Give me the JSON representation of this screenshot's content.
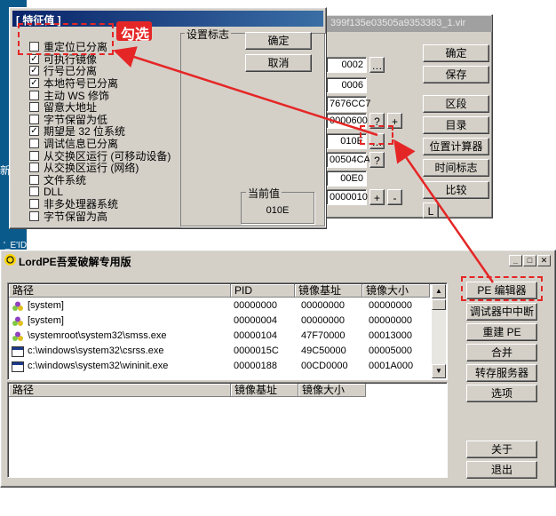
{
  "desktop": {
    "side_text": "新",
    "side_text2": "'_E'ID'"
  },
  "back_window": {
    "title": "399f135e03505a9353383_1.vir",
    "buttons": [
      "确定",
      "保存",
      "区段",
      "目录",
      "位置计算器",
      "时间标志",
      "比较"
    ],
    "small_L": "L",
    "values": [
      "0002",
      "0006",
      "7676CC7",
      "0000600",
      "010E",
      "00504CA",
      "00E0",
      "0000010"
    ]
  },
  "feature_dialog": {
    "title": "[ 特征值 ]",
    "flags": [
      {
        "label": "重定位已分离",
        "checked": false
      },
      {
        "label": "可执行镜像",
        "checked": true
      },
      {
        "label": "行号已分离",
        "checked": true
      },
      {
        "label": "本地符号已分离",
        "checked": true
      },
      {
        "label": "主动 WS 修饰",
        "checked": false
      },
      {
        "label": "留意大地址",
        "checked": false
      },
      {
        "label": "字节保留为低",
        "checked": false
      },
      {
        "label": "期望是 32 位系统",
        "checked": true
      },
      {
        "label": "调试信息已分离",
        "checked": false
      },
      {
        "label": "从交换区运行 (可移动设备)",
        "checked": false
      },
      {
        "label": "从交换区运行 (网络)",
        "checked": false
      },
      {
        "label": "文件系统",
        "checked": false
      },
      {
        "label": "DLL",
        "checked": false
      },
      {
        "label": "非多处理器系统",
        "checked": false
      },
      {
        "label": "字节保留为高",
        "checked": false
      }
    ],
    "group_label": "设置标志",
    "ok": "确定",
    "cancel": "取消",
    "current_label": "当前值",
    "current_value": "010E"
  },
  "annotation": {
    "text": "勾选",
    "color": "#e52626"
  },
  "lordpe": {
    "title": "LordPE吾爱破解专用版",
    "proc_headers": [
      "路径",
      "PID",
      "镜像基址",
      "镜像大小"
    ],
    "processes": [
      {
        "icon": "system-process-icon",
        "path": "[system]",
        "pid": "00000000",
        "base": "00000000",
        "size": "00000000"
      },
      {
        "icon": "system-process-icon",
        "path": "[system]",
        "pid": "00000004",
        "base": "00000000",
        "size": "00000000"
      },
      {
        "icon": "system-process-icon",
        "path": "\\systemroot\\system32\\smss.exe",
        "pid": "00000104",
        "base": "47F70000",
        "size": "00013000"
      },
      {
        "icon": "window-process-icon",
        "path": "c:\\windows\\system32\\csrss.exe",
        "pid": "0000015C",
        "base": "49C50000",
        "size": "00005000"
      },
      {
        "icon": "window-process-icon",
        "path": "c:\\windows\\system32\\wininit.exe",
        "pid": "00000188",
        "base": "00CD0000",
        "size": "0001A000"
      }
    ],
    "module_headers": [
      "路径",
      "镜像基址",
      "镜像大小"
    ],
    "side_buttons": [
      "PE 编辑器",
      "调试器中中断",
      "重建 PE",
      "合并",
      "转存服务器",
      "选项"
    ],
    "bottom_buttons": [
      "关于",
      "退出"
    ]
  }
}
